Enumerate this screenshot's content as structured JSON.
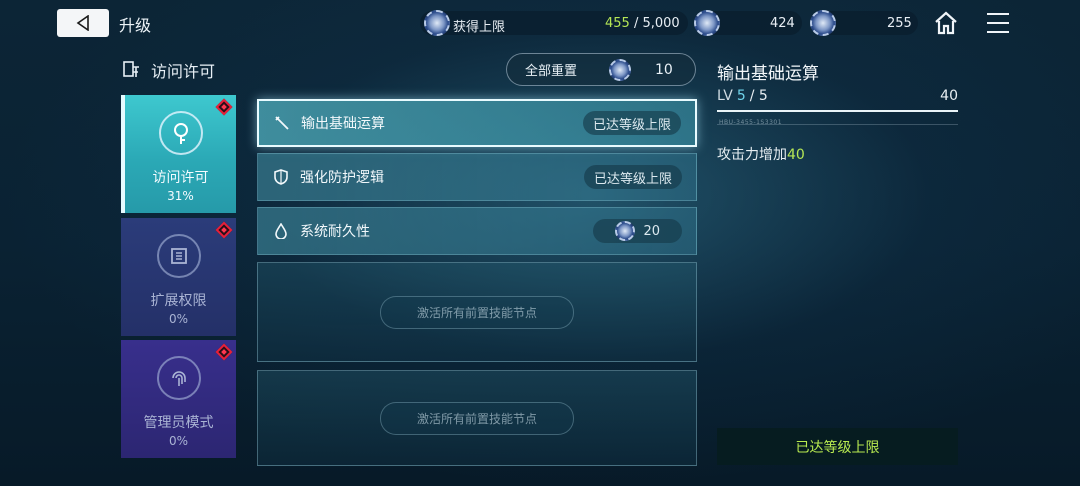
{
  "header": {
    "title": "升级",
    "cap_label": "获得上限",
    "cap_current": "455",
    "cap_total": "/ 5,000",
    "currency_a": "424",
    "currency_b": "255"
  },
  "section": {
    "title": "访问许可",
    "reset_label": "全部重置",
    "reset_cost": "10"
  },
  "categories": [
    {
      "name": "访问许可",
      "percent": "31%"
    },
    {
      "name": "扩展权限",
      "percent": "0%"
    },
    {
      "name": "管理员模式",
      "percent": "0%"
    }
  ],
  "skills": [
    {
      "name": "输出基础运算",
      "status": "已达等级上限",
      "icon": "sword-icon"
    },
    {
      "name": "强化防护逻辑",
      "status": "已达等级上限",
      "icon": "shield-icon"
    },
    {
      "name": "系统耐久性",
      "cost": "20",
      "icon": "droplet-icon"
    }
  ],
  "locked_slots": [
    {
      "text": "激活所有前置技能节点"
    },
    {
      "text": "激活所有前置技能节点"
    }
  ],
  "detail": {
    "title": "输出基础运算",
    "lv_label": "LV",
    "lv_current": "5",
    "lv_max": "/ 5",
    "value": "40",
    "progress": 1.0,
    "code": "HBU-3455-1S3301",
    "effect_prefix": "攻击力增加",
    "effect_value": "40",
    "maxed_label": "已达等级上限"
  },
  "colors": {
    "accent_green": "#b5e655",
    "active_tab": "#3ec8cf",
    "badge_red": "#e8203a"
  }
}
